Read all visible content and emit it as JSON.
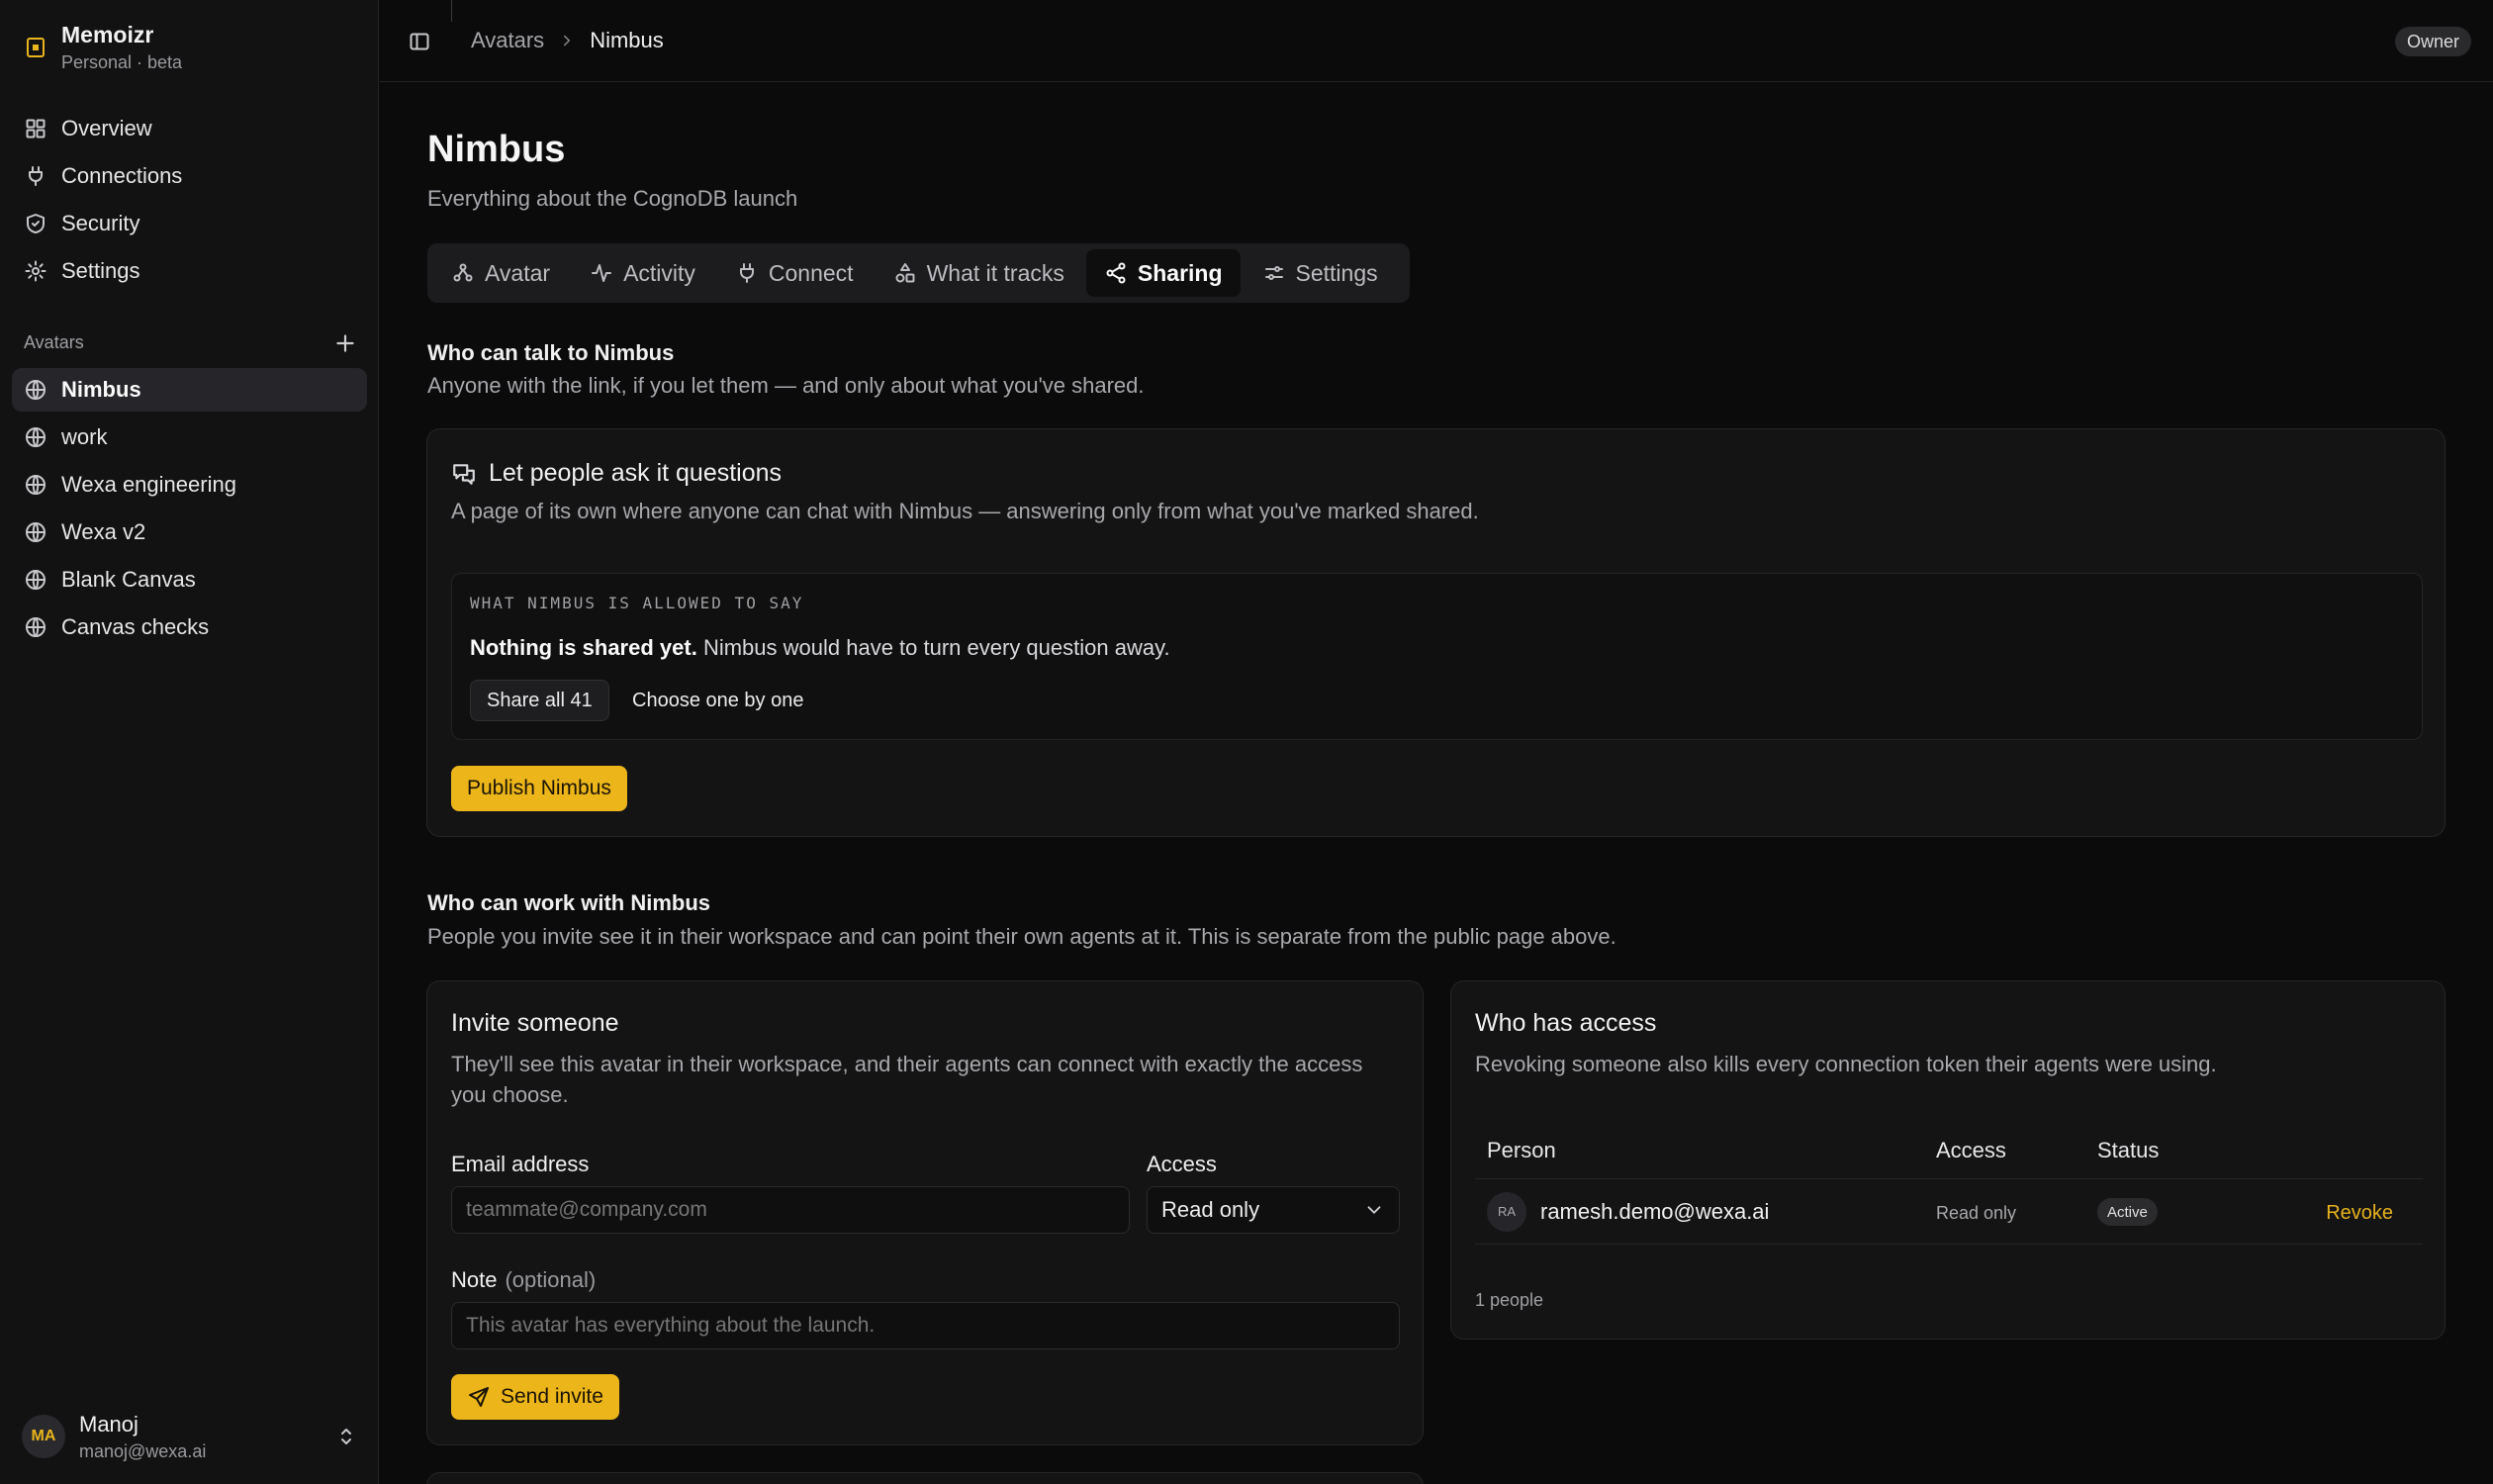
{
  "app": {
    "name": "Memoizr",
    "plan": "Personal · beta",
    "accent": "#ecb51a"
  },
  "sidebar": {
    "nav": [
      {
        "label": "Overview",
        "icon": "grid-icon"
      },
      {
        "label": "Connections",
        "icon": "plug-icon"
      },
      {
        "label": "Security",
        "icon": "shield-icon"
      },
      {
        "label": "Settings",
        "icon": "gear-icon"
      }
    ],
    "avatars_label": "Avatars",
    "avatars": [
      {
        "label": "Nimbus",
        "active": true
      },
      {
        "label": "work"
      },
      {
        "label": "Wexa engineering"
      },
      {
        "label": "Wexa v2"
      },
      {
        "label": "Blank Canvas"
      },
      {
        "label": "Canvas checks"
      }
    ],
    "user": {
      "initials": "MA",
      "name": "Manoj",
      "email": "manoj@wexa.ai"
    }
  },
  "topbar": {
    "breadcrumb": {
      "parent": "Avatars",
      "current": "Nimbus"
    },
    "role_badge": "Owner"
  },
  "page": {
    "title": "Nimbus",
    "subtitle": "Everything about the CognoDB launch"
  },
  "tabs": [
    {
      "label": "Avatar",
      "icon": "avatar-icon"
    },
    {
      "label": "Activity",
      "icon": "activity-icon"
    },
    {
      "label": "Connect",
      "icon": "plug-icon"
    },
    {
      "label": "What it tracks",
      "icon": "shapes-icon"
    },
    {
      "label": "Sharing",
      "icon": "share-icon",
      "active": true
    },
    {
      "label": "Settings",
      "icon": "sliders-icon"
    }
  ],
  "public_section": {
    "title": "Who can talk to Nimbus",
    "subtitle": "Anyone with the link, if you let them — and only about what you've shared.",
    "card": {
      "title": "Let people ask it questions",
      "subtitle": "A page of its own where anyone can chat with Nimbus — answering only from what you've marked shared.",
      "allowed_label": "WHAT NIMBUS IS ALLOWED TO SAY",
      "allowed_strong": "Nothing is shared yet.",
      "allowed_rest": " Nimbus would have to turn every question away.",
      "share_all": "Share all 41",
      "choose": "Choose one by one",
      "publish": "Publish Nimbus"
    }
  },
  "work_section": {
    "title": "Who can work with Nimbus",
    "subtitle": "People you invite see it in their workspace and can point their own agents at it. This is separate from the public page above."
  },
  "invite": {
    "title": "Invite someone",
    "subtitle": "They'll see this avatar in their workspace, and their agents can connect with exactly the access you choose.",
    "email_label": "Email address",
    "email_placeholder": "teammate@company.com",
    "access_label": "Access",
    "access_value": "Read only",
    "note_label": "Note",
    "note_optional": "(optional)",
    "note_placeholder": "This avatar has everything about the launch.",
    "send": "Send invite"
  },
  "access": {
    "title": "Who has access",
    "subtitle": "Revoking someone also kills every connection token their agents were using.",
    "columns": [
      "Person",
      "Access",
      "Status"
    ],
    "rows": [
      {
        "initials": "RA",
        "email": "ramesh.demo@wexa.ai",
        "access": "Read only",
        "status": "Active",
        "action": "Revoke"
      }
    ],
    "count": "1 people"
  }
}
